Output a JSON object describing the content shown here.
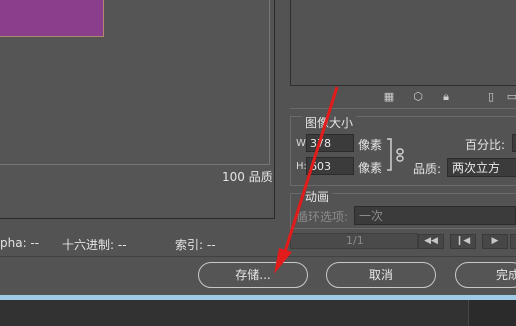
{
  "preview": {
    "quality_text": "100 品质"
  },
  "image_size": {
    "title": "图像大小",
    "w_label": "W:",
    "h_label": "H:",
    "w_value": "378",
    "h_value": "603",
    "unit_w": "像素",
    "unit_h": "像素",
    "percent_label": "百分比:",
    "quality_label": "品质:",
    "quality_value": "两次立方"
  },
  "animation": {
    "title": "动画",
    "loop_label": "循环选项:",
    "loop_value": "一次",
    "frame_counter": "1/1"
  },
  "status": {
    "alpha": "pha: --",
    "hex": "十六进制: --",
    "index": "索引: --"
  },
  "buttons": {
    "save": "存储...",
    "cancel": "取消",
    "done": "完成"
  },
  "icons": {
    "toolbar": [
      "checker-icon",
      "cube-icon",
      "lock-icon",
      "new-icon",
      "trash-icon"
    ],
    "nav": [
      "first-frame-icon",
      "prev-frame-icon",
      "play-icon",
      "last-frame-icon"
    ]
  },
  "colors": {
    "accent": "#9fcbe8",
    "arrow": "#e21b1b",
    "swatch": "#8a3f8c"
  }
}
